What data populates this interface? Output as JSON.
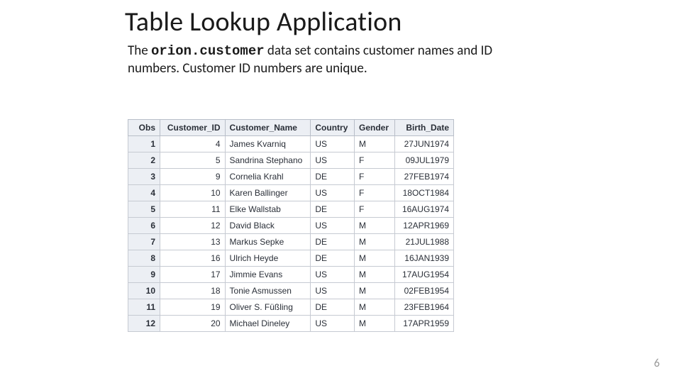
{
  "title": "Table Lookup Application",
  "subtitle_pre": "The ",
  "subtitle_code": "orion.customer",
  "subtitle_post": " data set contains customer names and ID numbers. Customer ID numbers are unique.",
  "page_number": "6",
  "table": {
    "headers": {
      "obs": "Obs",
      "customer_id": "Customer_ID",
      "customer_name": "Customer_Name",
      "country": "Country",
      "gender": "Gender",
      "birth_date": "Birth_Date"
    },
    "rows": [
      {
        "obs": "1",
        "customer_id": "4",
        "customer_name": "James Kvarniq",
        "country": "US",
        "gender": "M",
        "birth_date": "27JUN1974"
      },
      {
        "obs": "2",
        "customer_id": "5",
        "customer_name": "Sandrina Stephano",
        "country": "US",
        "gender": "F",
        "birth_date": "09JUL1979"
      },
      {
        "obs": "3",
        "customer_id": "9",
        "customer_name": "Cornelia Krahl",
        "country": "DE",
        "gender": "F",
        "birth_date": "27FEB1974"
      },
      {
        "obs": "4",
        "customer_id": "10",
        "customer_name": "Karen Ballinger",
        "country": "US",
        "gender": "F",
        "birth_date": "18OCT1984"
      },
      {
        "obs": "5",
        "customer_id": "11",
        "customer_name": "Elke Wallstab",
        "country": "DE",
        "gender": "F",
        "birth_date": "16AUG1974"
      },
      {
        "obs": "6",
        "customer_id": "12",
        "customer_name": "David Black",
        "country": "US",
        "gender": "M",
        "birth_date": "12APR1969"
      },
      {
        "obs": "7",
        "customer_id": "13",
        "customer_name": "Markus Sepke",
        "country": "DE",
        "gender": "M",
        "birth_date": "21JUL1988"
      },
      {
        "obs": "8",
        "customer_id": "16",
        "customer_name": "Ulrich Heyde",
        "country": "DE",
        "gender": "M",
        "birth_date": "16JAN1939"
      },
      {
        "obs": "9",
        "customer_id": "17",
        "customer_name": "Jimmie Evans",
        "country": "US",
        "gender": "M",
        "birth_date": "17AUG1954"
      },
      {
        "obs": "10",
        "customer_id": "18",
        "customer_name": "Tonie Asmussen",
        "country": "US",
        "gender": "M",
        "birth_date": "02FEB1954"
      },
      {
        "obs": "11",
        "customer_id": "19",
        "customer_name": "Oliver S. Füßling",
        "country": "DE",
        "gender": "M",
        "birth_date": "23FEB1964"
      },
      {
        "obs": "12",
        "customer_id": "20",
        "customer_name": "Michael Dineley",
        "country": "US",
        "gender": "M",
        "birth_date": "17APR1959"
      }
    ]
  }
}
